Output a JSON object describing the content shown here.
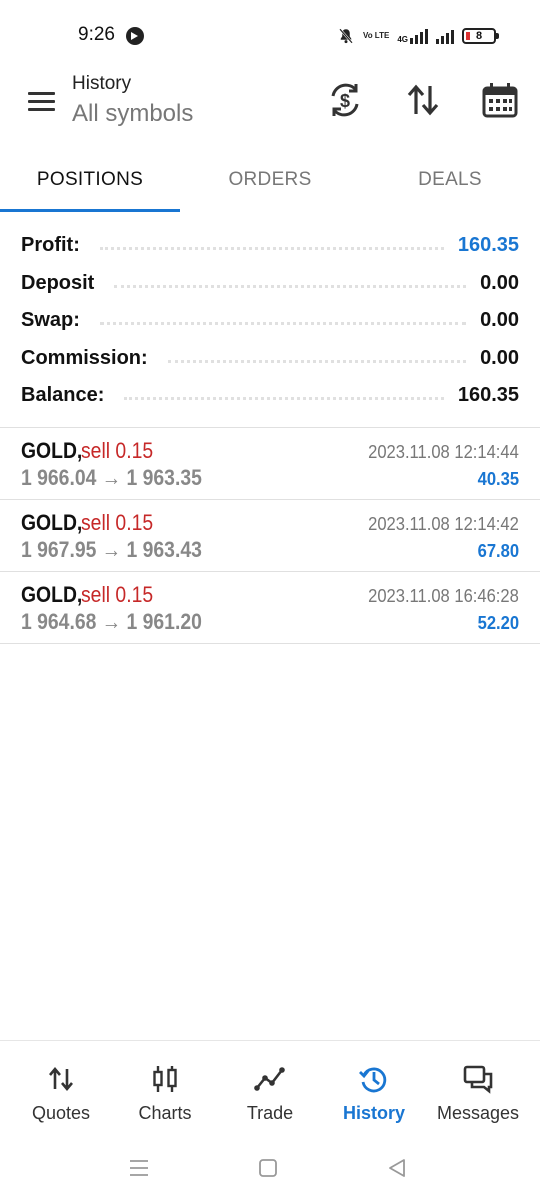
{
  "status_bar": {
    "time": "9:26",
    "network": "4G",
    "volte": "Vo LTE",
    "battery": "8"
  },
  "header": {
    "title": "History",
    "subtitle": "All symbols"
  },
  "tabs": [
    {
      "label": "POSITIONS",
      "active": true
    },
    {
      "label": "ORDERS",
      "active": false
    },
    {
      "label": "DEALS",
      "active": false
    }
  ],
  "summary": [
    {
      "label": "Profit:",
      "value": "160.35",
      "highlight": true
    },
    {
      "label": "Deposit",
      "value": "0.00",
      "highlight": false
    },
    {
      "label": "Swap:",
      "value": "0.00",
      "highlight": false
    },
    {
      "label": "Commission:",
      "value": "0.00",
      "highlight": false
    },
    {
      "label": "Balance:",
      "value": "160.35",
      "highlight": false
    }
  ],
  "deals": [
    {
      "symbol": "GOLD,",
      "side": "sell 0.15",
      "open_price": "1 966.04",
      "arrow": "→",
      "close_price": "1 963.35",
      "time": "2023.11.08 12:14:44",
      "profit": "40.35"
    },
    {
      "symbol": "GOLD,",
      "side": "sell 0.15",
      "open_price": "1 967.95",
      "arrow": "→",
      "close_price": "1 963.43",
      "time": "2023.11.08 12:14:42",
      "profit": "67.80"
    },
    {
      "symbol": "GOLD,",
      "side": "sell 0.15",
      "open_price": "1 964.68",
      "arrow": "→",
      "close_price": "1 961.20",
      "time": "2023.11.08 16:46:28",
      "profit": "52.20"
    }
  ],
  "bottom_nav": [
    {
      "label": "Quotes",
      "icon": "quotes-icon",
      "active": false
    },
    {
      "label": "Charts",
      "icon": "charts-icon",
      "active": false
    },
    {
      "label": "Trade",
      "icon": "trade-icon",
      "active": false
    },
    {
      "label": "History",
      "icon": "history-icon",
      "active": true
    },
    {
      "label": "Messages",
      "icon": "messages-icon",
      "active": false
    }
  ],
  "colors": {
    "accent": "#1976d2",
    "sell": "#c62828",
    "muted": "#888888"
  }
}
